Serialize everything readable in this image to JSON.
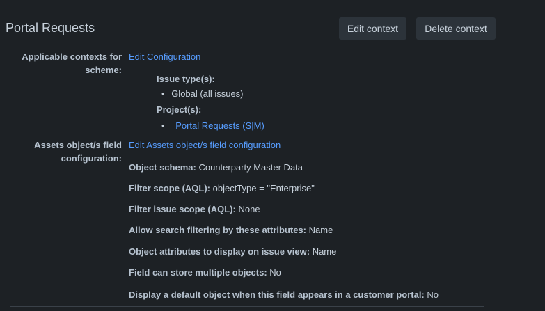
{
  "header": {
    "title": "Portal Requests",
    "edit_context": "Edit context",
    "delete_context": "Delete context"
  },
  "contexts": {
    "label_line1": "Applicable contexts for",
    "label_line2": "scheme:",
    "edit_link": "Edit Configuration",
    "issue_types_heading": "Issue type(s):",
    "issue_types": [
      "Global (all issues)"
    ],
    "projects_heading": "Project(s):",
    "projects": [
      "Portal Requests (S|M)"
    ]
  },
  "assets": {
    "label_line1": "Assets object/s field",
    "label_line2": "configuration:",
    "edit_link": "Edit Assets object/s field configuration",
    "rows": [
      {
        "key": "Object schema:",
        "value": "Counterparty Master Data"
      },
      {
        "key": "Filter scope (AQL):",
        "value": "objectType = \"Enterprise\""
      },
      {
        "key": "Filter issue scope (AQL):",
        "value": "None"
      },
      {
        "key": "Allow search filtering by these attributes:",
        "value": "Name"
      },
      {
        "key": "Object attributes to display on issue view:",
        "value": "Name"
      },
      {
        "key": "Field can store multiple objects:",
        "value": "No"
      },
      {
        "key": "Display a default object when this field appears in a customer portal:",
        "value": "No"
      }
    ]
  }
}
